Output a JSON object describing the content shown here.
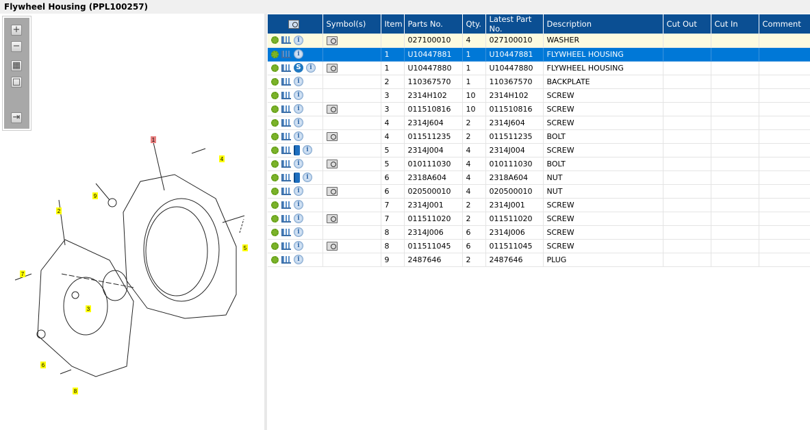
{
  "title": "Flywheel Housing (PPL100257)",
  "toolbar": [
    {
      "name": "zoom-in",
      "glyph": "+"
    },
    {
      "name": "zoom-out",
      "glyph": "−"
    },
    {
      "name": "fit-all",
      "glyph": "▦"
    },
    {
      "name": "fit-window",
      "glyph": "□"
    },
    {
      "name": "export",
      "glyph": "⇥"
    }
  ],
  "diagram": {
    "callouts": [
      "1",
      "2",
      "3",
      "4",
      "5",
      "6",
      "7",
      "8",
      "9"
    ],
    "highlight_color": "#ffff00",
    "selected_color": "#e88080"
  },
  "columns": [
    "",
    "Symbol(s)",
    "Item",
    "Parts No.",
    "Qty.",
    "Latest Part No.",
    "Description",
    "Cut Out",
    "Cut In",
    "Comment"
  ],
  "rows": [
    {
      "icons": [
        "gear",
        "cart",
        "info"
      ],
      "symbol": true,
      "item": "",
      "part": "027100010",
      "qty": "4",
      "latest": "027100010",
      "desc": "WASHER",
      "state": "highlight"
    },
    {
      "icons": [
        "gear",
        "cart",
        "info"
      ],
      "symbol": false,
      "item": "1",
      "part": "U10447881",
      "qty": "1",
      "latest": "U10447881",
      "desc": "FLYWHEEL HOUSING",
      "state": "selected"
    },
    {
      "icons": [
        "gear",
        "cart",
        "s",
        "info"
      ],
      "symbol": true,
      "item": "1",
      "part": "U10447880",
      "qty": "1",
      "latest": "U10447880",
      "desc": "FLYWHEEL HOUSING"
    },
    {
      "icons": [
        "gear",
        "cart",
        "info"
      ],
      "symbol": false,
      "item": "2",
      "part": "110367570",
      "qty": "1",
      "latest": "110367570",
      "desc": "BACKPLATE"
    },
    {
      "icons": [
        "gear",
        "cart",
        "info"
      ],
      "symbol": false,
      "item": "3",
      "part": "2314H102",
      "qty": "10",
      "latest": "2314H102",
      "desc": "SCREW"
    },
    {
      "icons": [
        "gear",
        "cart",
        "info"
      ],
      "symbol": true,
      "item": "3",
      "part": "011510816",
      "qty": "10",
      "latest": "011510816",
      "desc": "SCREW"
    },
    {
      "icons": [
        "gear",
        "cart",
        "info"
      ],
      "symbol": false,
      "item": "4",
      "part": "2314J604",
      "qty": "2",
      "latest": "2314J604",
      "desc": "SCREW"
    },
    {
      "icons": [
        "gear",
        "cart",
        "info"
      ],
      "symbol": true,
      "item": "4",
      "part": "011511235",
      "qty": "2",
      "latest": "011511235",
      "desc": "BOLT"
    },
    {
      "icons": [
        "gear",
        "cart",
        "book",
        "info"
      ],
      "symbol": false,
      "item": "5",
      "part": "2314J004",
      "qty": "4",
      "latest": "2314J004",
      "desc": "SCREW"
    },
    {
      "icons": [
        "gear",
        "cart",
        "info"
      ],
      "symbol": true,
      "item": "5",
      "part": "010111030",
      "qty": "4",
      "latest": "010111030",
      "desc": "BOLT"
    },
    {
      "icons": [
        "gear",
        "cart",
        "book",
        "info"
      ],
      "symbol": false,
      "item": "6",
      "part": "2318A604",
      "qty": "4",
      "latest": "2318A604",
      "desc": "NUT"
    },
    {
      "icons": [
        "gear",
        "cart",
        "info"
      ],
      "symbol": true,
      "item": "6",
      "part": "020500010",
      "qty": "4",
      "latest": "020500010",
      "desc": "NUT"
    },
    {
      "icons": [
        "gear",
        "cart",
        "info"
      ],
      "symbol": false,
      "item": "7",
      "part": "2314J001",
      "qty": "2",
      "latest": "2314J001",
      "desc": "SCREW"
    },
    {
      "icons": [
        "gear",
        "cart",
        "info"
      ],
      "symbol": true,
      "item": "7",
      "part": "011511020",
      "qty": "2",
      "latest": "011511020",
      "desc": "SCREW"
    },
    {
      "icons": [
        "gear",
        "cart",
        "info"
      ],
      "symbol": false,
      "item": "8",
      "part": "2314J006",
      "qty": "6",
      "latest": "2314J006",
      "desc": "SCREW"
    },
    {
      "icons": [
        "gear",
        "cart",
        "info"
      ],
      "symbol": true,
      "item": "8",
      "part": "011511045",
      "qty": "6",
      "latest": "011511045",
      "desc": "SCREW"
    },
    {
      "icons": [
        "gear",
        "cart",
        "info"
      ],
      "symbol": false,
      "item": "9",
      "part": "2487646",
      "qty": "2",
      "latest": "2487646",
      "desc": "PLUG"
    }
  ]
}
